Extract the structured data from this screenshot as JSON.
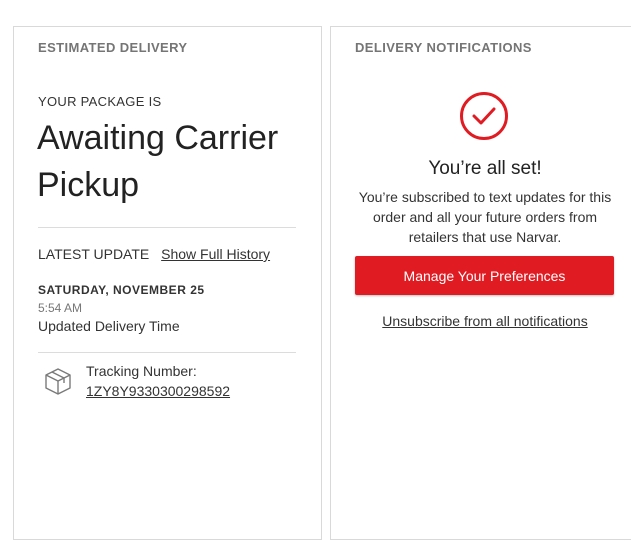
{
  "estimated_delivery": {
    "title": "ESTIMATED DELIVERY",
    "package_label": "YOUR PACKAGE IS",
    "status": "Awaiting Carrier Pickup",
    "latest_update_label": "LATEST UPDATE",
    "show_history_link": "Show Full History",
    "latest_event": {
      "date": "SATURDAY, NOVEMBER 25",
      "time": "5:54 AM",
      "description": "Updated Delivery Time"
    },
    "tracking_label": "Tracking Number:",
    "tracking_number": "1ZY8Y9330300298592",
    "icon": "package-box-icon"
  },
  "delivery_notifications": {
    "title": "DELIVERY NOTIFICATIONS",
    "icon": "checkmark-circle-icon",
    "accent_color": "#e01b22",
    "confirmation_title": "You’re all set!",
    "confirmation_text": "You’re subscribed to text updates for this order and all your future orders from retailers that use Narvar.",
    "manage_button_label": "Manage Your Preferences",
    "unsubscribe_link": "Unsubscribe from all notifications"
  }
}
